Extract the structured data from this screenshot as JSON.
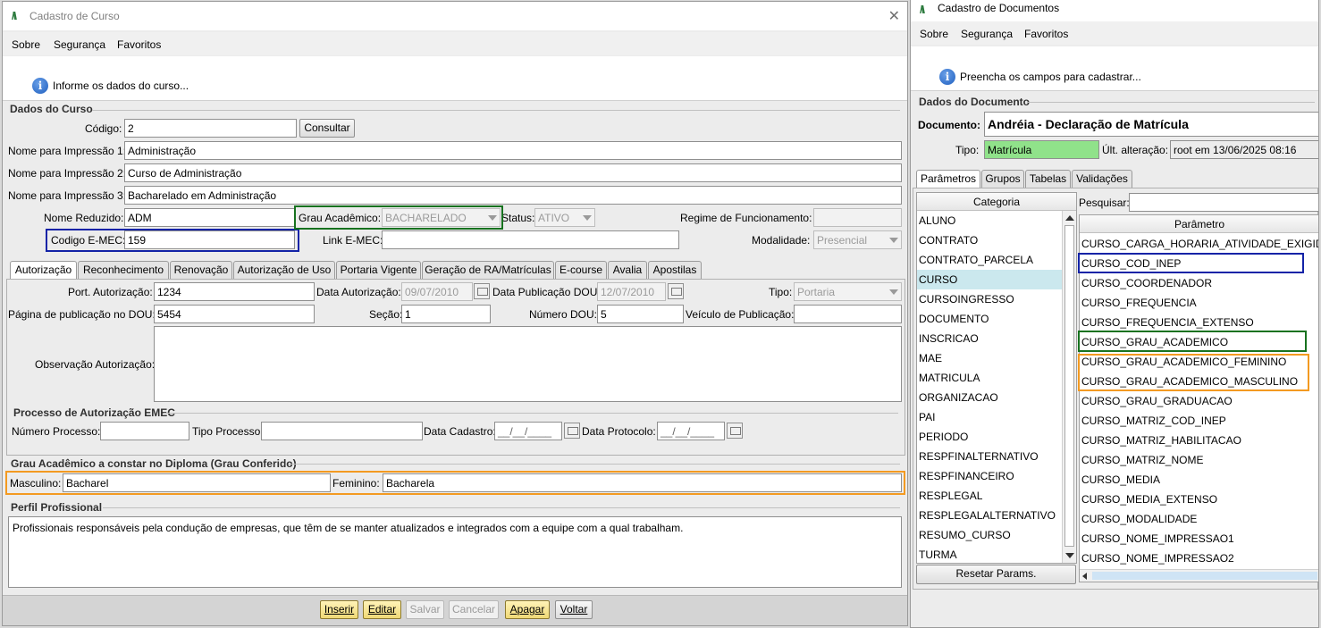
{
  "left_window": {
    "title": "Cadastro de Curso",
    "menu": [
      "Sobre",
      "Segurança",
      "Favoritos"
    ],
    "info_text": "Informe os dados do curso...",
    "section_dados": "Dados do Curso",
    "fields": {
      "codigo_label": "Código:",
      "codigo": "2",
      "consultar": "Consultar",
      "nome1_label": "Nome para Impressão 1:",
      "nome1": "Administração",
      "nome2_label": "Nome para Impressão 2:",
      "nome2": "Curso de Administração",
      "nome3_label": "Nome para Impressão 3:",
      "nome3": "Bacharelado em Administração",
      "nome_reduzido_label": "Nome Reduzido:",
      "nome_reduzido": "ADM",
      "grau_label": "Grau Acadêmico:",
      "grau": "BACHARELADO",
      "status_label": "Status:",
      "status": "ATIVO",
      "regime_label": "Regime de Funcionamento:",
      "regime": "",
      "emec_label": "Codigo E-MEC:",
      "emec": "159",
      "link_label": "Link E-MEC:",
      "link": "",
      "modalidade_label": "Modalidade:",
      "modalidade": "Presencial"
    },
    "tabs": [
      "Autorização",
      "Reconhecimento",
      "Renovação",
      "Autorização de Uso",
      "Portaria Vigente",
      "Geração de RA/Matrículas",
      "E-course",
      "Avalia",
      "Apostilas"
    ],
    "autorizacao": {
      "port_label": "Port. Autorização:",
      "port": "1234",
      "data_aut_label": "Data Autorização:",
      "data_aut": "09/07/2010",
      "data_pub_label": "Data Publicação DOU:",
      "data_pub": "12/07/2010",
      "tipo_label": "Tipo:",
      "tipo": "Portaria",
      "pagina_label": "Página de publicação no DOU:",
      "pagina": "5454",
      "secao_label": "Seção:",
      "secao": "1",
      "numero_label": "Número DOU:",
      "numero": "5",
      "veiculo_label": "Veículo de Publicação:",
      "veiculo": "",
      "obs_label": "Observação Autorização:"
    },
    "processo": {
      "title": "Processo de Autorização EMEC",
      "numero_label": "Número Processo:",
      "tipo_label": "Tipo Processo:",
      "data_cad_label": "Data Cadastro:",
      "data_cad": "__/__/____",
      "data_prot_label": "Data Protocolo:",
      "data_prot": "__/__/____"
    },
    "grau_diploma": {
      "title": "Grau Acadêmico a constar no Diploma (Grau Conferido)",
      "masc_label": "Masculino:",
      "masc": "Bacharel",
      "fem_label": "Feminino:",
      "fem": "Bacharela"
    },
    "perfil": {
      "title": "Perfil Profissional",
      "text": "Profissionais responsáveis pela condução de empresas, que têm de se manter atualizados e integrados com a equipe com a qual trabalham."
    },
    "buttons": {
      "inserir": "Inserir",
      "editar": "Editar",
      "salvar": "Salvar",
      "cancelar": "Cancelar",
      "apagar": "Apagar",
      "voltar": "Voltar"
    }
  },
  "right_window": {
    "title": "Cadastro de Documentos",
    "menu": [
      "Sobre",
      "Segurança",
      "Favoritos"
    ],
    "info_text": "Preencha os campos para cadastrar...",
    "section": "Dados do Documento",
    "documento_label": "Documento:",
    "documento": "Andréia - Declaração de Matrícula",
    "tipo_label": "Tipo:",
    "tipo": "Matrícula",
    "ult_label": "Últ. alteração:",
    "ult": "root em 13/06/2025 08:16",
    "tabs": [
      "Parâmetros",
      "Grupos",
      "Tabelas",
      "Validações"
    ],
    "categoria_header": "Categoria",
    "categorias": [
      "ALUNO",
      "CONTRATO",
      "CONTRATO_PARCELA",
      "CURSO",
      "CURSOINGRESSO",
      "DOCUMENTO",
      "INSCRICAO",
      "MAE",
      "MATRICULA",
      "ORGANIZACAO",
      "PAI",
      "PERIODO",
      "RESPFINALTERNATIVO",
      "RESPFINANCEIRO",
      "RESPLEGAL",
      "RESPLEGALALTERNATIVO",
      "RESUMO_CURSO",
      "TURMA"
    ],
    "pesquisar_label": "Pesquisar:",
    "parametro_header": "Parâmetro",
    "parametros": [
      "CURSO_CARGA_HORARIA_ATIVIDADE_EXIGIDA",
      "CURSO_COD_INEP",
      "CURSO_COORDENADOR",
      "CURSO_FREQUENCIA",
      "CURSO_FREQUENCIA_EXTENSO",
      "CURSO_GRAU_ACADEMICO",
      "CURSO_GRAU_ACADEMICO_FEMININO",
      "CURSO_GRAU_ACADEMICO_MASCULINO",
      "CURSO_GRAU_GRADUACAO",
      "CURSO_MATRIZ_COD_INEP",
      "CURSO_MATRIZ_HABILITACAO",
      "CURSO_MATRIZ_NOME",
      "CURSO_MEDIA",
      "CURSO_MEDIA_EXTENSO",
      "CURSO_MODALIDADE",
      "CURSO_NOME_IMPRESSAO1",
      "CURSO_NOME_IMPRESSAO2"
    ],
    "resetar": "Resetar Params."
  }
}
